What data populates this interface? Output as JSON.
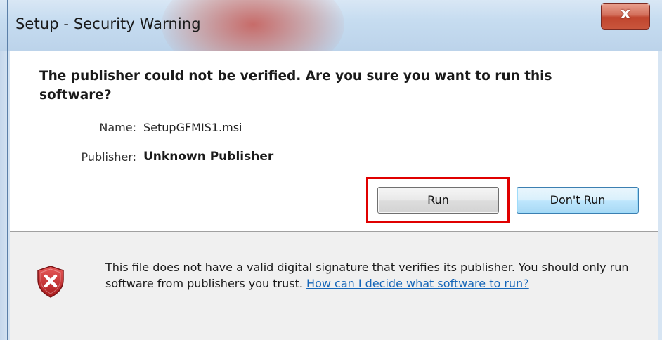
{
  "window": {
    "title": "Setup - Security Warning",
    "close_label": "x"
  },
  "dialog": {
    "headline": "The publisher could not be verified.  Are you sure you want to run this software?",
    "name_label": "Name:",
    "name_value": "SetupGFMIS1.msi",
    "publisher_label": "Publisher:",
    "publisher_value": "Unknown Publisher",
    "run_label": "Run",
    "dont_run_label": "Don't Run"
  },
  "footer": {
    "message": "This file does not have a valid digital signature that verifies its publisher. You should only run software from publishers you trust.",
    "help_link": "How can I decide what software to run?"
  },
  "icons": {
    "warning": "shield-x-icon"
  },
  "colors": {
    "highlight": "#e00000",
    "link": "#1666b8",
    "shield": "#c8282a"
  }
}
